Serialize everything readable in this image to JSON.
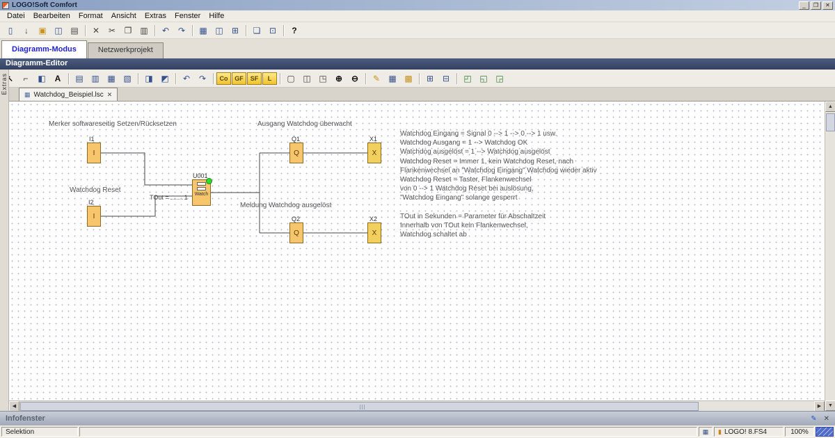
{
  "colors": {
    "titlebar_gradient_start": "#8aa0c2",
    "titlebar_gradient_end": "#c3cfe2",
    "editor_header": "#3c4b6e",
    "active_tab_text": "#2222cc",
    "block_fill": "#f6c56c",
    "block_border": "#8a6a20",
    "led_green": "#2edc2e",
    "palette_yellow": "#f2c22e",
    "grip_blue": "#4f6cc8"
  },
  "titlebar": {
    "title": "LOGO!Soft Comfort",
    "minimize_glyph": "_",
    "maximize_glyph": "❒",
    "close_glyph": "✕"
  },
  "menubar": {
    "items": [
      "Datei",
      "Bearbeiten",
      "Format",
      "Ansicht",
      "Extras",
      "Fenster",
      "Hilfe"
    ]
  },
  "main_toolbar": {
    "buttons": [
      {
        "name": "new-file",
        "glyph": "▯"
      },
      {
        "name": "transfer",
        "glyph": "↓"
      },
      {
        "name": "open",
        "glyph": "▣"
      },
      {
        "name": "save",
        "glyph": "◫"
      },
      {
        "name": "print",
        "glyph": "▤"
      },
      {
        "name": "delete",
        "glyph": "✕"
      },
      {
        "name": "cut",
        "glyph": "✂"
      },
      {
        "name": "copy",
        "glyph": "❐"
      },
      {
        "name": "paste",
        "glyph": "▥"
      },
      {
        "name": "undo",
        "glyph": "↶"
      },
      {
        "name": "redo",
        "glyph": "↷"
      },
      {
        "name": "network-project",
        "glyph": "▦"
      },
      {
        "name": "compare",
        "glyph": "◫"
      },
      {
        "name": "convert",
        "glyph": "⊞"
      },
      {
        "name": "window-cascade",
        "glyph": "❏"
      },
      {
        "name": "properties",
        "glyph": "⊡"
      },
      {
        "name": "help",
        "glyph": "?"
      }
    ]
  },
  "mode_tabs": [
    {
      "label": "Diagramm-Modus",
      "active": true
    },
    {
      "label": "Netzwerkprojekt",
      "active": false
    }
  ],
  "editor": {
    "header_title": "Diagramm-Editor"
  },
  "editor_toolbar": {
    "buttons": [
      {
        "name": "select-tool",
        "glyph": "↖"
      },
      {
        "name": "connect-tool",
        "glyph": "⌐"
      },
      {
        "name": "marker-tool",
        "glyph": "◧"
      },
      {
        "name": "text-tool",
        "glyph": "A"
      },
      {
        "name": "align-top",
        "glyph": "▤"
      },
      {
        "name": "align-bottom",
        "glyph": "▥"
      },
      {
        "name": "align-horizontal",
        "glyph": "▦"
      },
      {
        "name": "align-vertical",
        "glyph": "▧"
      },
      {
        "name": "auto-align",
        "glyph": "◨"
      },
      {
        "name": "spacing",
        "glyph": "◩"
      },
      {
        "name": "undo",
        "glyph": "↶"
      },
      {
        "name": "redo",
        "glyph": "↷"
      },
      {
        "name": "co-palette",
        "glyph": "Co"
      },
      {
        "name": "gf-palette",
        "glyph": "GF"
      },
      {
        "name": "sf-palette",
        "glyph": "SF"
      },
      {
        "name": "l-palette",
        "glyph": "L"
      },
      {
        "name": "page-layout",
        "glyph": "▢"
      },
      {
        "name": "split-view",
        "glyph": "◫"
      },
      {
        "name": "overview",
        "glyph": "◳"
      },
      {
        "name": "zoom-in",
        "glyph": "⊕"
      },
      {
        "name": "zoom-out",
        "glyph": "⊖"
      },
      {
        "name": "pencil",
        "glyph": "✎"
      },
      {
        "name": "grid",
        "glyph": "▦"
      },
      {
        "name": "snap-grid",
        "glyph": "▩"
      },
      {
        "name": "reference",
        "glyph": "⊞"
      },
      {
        "name": "label-tool",
        "glyph": "⊟"
      },
      {
        "name": "window-split-a",
        "glyph": "◰"
      },
      {
        "name": "window-split-b",
        "glyph": "◱"
      },
      {
        "name": "window-split-c",
        "glyph": "◲"
      }
    ]
  },
  "extras": {
    "label": "Extras"
  },
  "document": {
    "icon_glyph": "▦",
    "tab_label": "Watchdog_Beispiel.lsc",
    "close_glyph": "✕"
  },
  "diagram": {
    "annotations": {
      "marker_label": "Merker softwareseitig Setzen/Rücksetzen",
      "reset_label": "Watchdog Reset",
      "output_label": "Ausgang Watchdog überwacht",
      "message_label": "Meldung Watchdog ausgelöst",
      "param_label": "TOut =",
      "param_value": "1"
    },
    "blocks": [
      {
        "id": "I1",
        "letter": "I"
      },
      {
        "id": "I2",
        "letter": "I"
      },
      {
        "id": "U001",
        "letter": "",
        "sub": "Watch"
      },
      {
        "id": "Q1",
        "letter": "Q"
      },
      {
        "id": "Q2",
        "letter": "Q"
      },
      {
        "id": "X1",
        "letter": "X"
      },
      {
        "id": "X2",
        "letter": "X"
      }
    ],
    "comment_lines": [
      "Watchdog Eingang = Signal 0 --> 1 --> 0 --> 1 usw.",
      "Watchdog Ausgang = 1 --> Watchdog OK",
      "Watchdog ausgelöst = 1 --> Watchdog ausgelöst",
      "Watchdog Reset = Immer 1, kein Watchdog Reset, nach",
      "Flankenwechsel an \"Watchdog Eingang\" Watchdog wieder aktiv",
      "Watchdog Reset = Taster, Flankenwechsel",
      "von 0 --> 1 Watchdog Reset bei auslösung,",
      "\"Watchdog Eingang\" solange gesperrt",
      "",
      "TOut in Sekunden = Parameter für Abschaltzeit",
      "Innerhalb von TOut kein Flankenwechsel,",
      "Watchdog schaltet ab"
    ]
  },
  "info_panel": {
    "title": "Infofenster",
    "edit_glyph": "✎",
    "close_glyph": "✕"
  },
  "statusbar": {
    "left": "Selektion",
    "interface_glyph": "▦",
    "device_glyph": "▮",
    "device": "LOGO! 8.FS4",
    "zoom": "100%"
  },
  "scrollbars": {
    "up_glyph": "▲",
    "down_glyph": "▼",
    "left_glyph": "◀",
    "right_glyph": "▶"
  }
}
